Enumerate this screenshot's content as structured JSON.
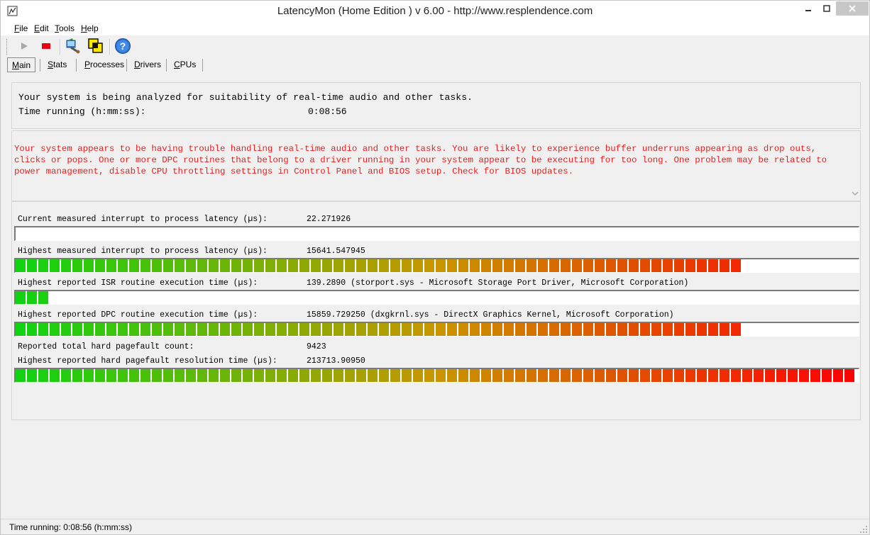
{
  "window": {
    "title": "LatencyMon  (Home Edition )  v 6.00 - http://www.resplendence.com"
  },
  "menu": [
    {
      "key": "F",
      "rest": "ile"
    },
    {
      "key": "E",
      "rest": "dit"
    },
    {
      "key": "T",
      "rest": "ools"
    },
    {
      "key": "H",
      "rest": "elp"
    }
  ],
  "toolbar": {
    "icons": [
      "play-icon",
      "stop-icon",
      "driver-check-icon",
      "windows-icon",
      "help-icon"
    ]
  },
  "tabs": [
    {
      "key": "M",
      "rest": "ain",
      "active": true
    },
    {
      "key": "S",
      "rest": "tats",
      "active": false
    },
    {
      "key": "P",
      "rest": "rocesses",
      "active": false
    },
    {
      "key": "D",
      "rest": "rivers",
      "active": false
    },
    {
      "key": "C",
      "rest": "PUs",
      "active": false
    }
  ],
  "summary": {
    "analysis_text": "Your system is being analyzed for suitability of real-time audio and other tasks.",
    "time_label": "Time running (h:mm:ss):",
    "time_value": "0:08:56"
  },
  "warning": {
    "text": "Your system appears to be having trouble handling real-time audio and other tasks. You are likely to experience buffer underruns appearing as drop outs, clicks or pops. One or more DPC routines that belong to a driver running in your system appear to be executing for too long. One problem may be related to power management, disable CPU throttling settings in Control Panel and BIOS setup. Check for BIOS updates.",
    "color": "#e81e1e"
  },
  "stats": {
    "current_latency": {
      "label": "Current measured interrupt to process latency (µs):",
      "value": "22.271926",
      "meter_level": 0.0
    },
    "highest_latency": {
      "label": "Highest measured interrupt to process latency (µs):",
      "value": "15641.547945",
      "meter_level": 0.86
    },
    "highest_isr": {
      "label": "Highest reported ISR routine execution time (µs):",
      "value": "139.2890  (storport.sys - Microsoft Storage Port Driver, Microsoft Corporation)",
      "meter_level": 0.04
    },
    "highest_dpc": {
      "label": "Highest reported DPC routine execution time (µs):",
      "value": "15859.729250  (dxgkrnl.sys - DirectX Graphics Kernel, Microsoft Corporation)",
      "meter_level": 0.86
    },
    "pagefault_count": {
      "label": "Reported total hard pagefault count:",
      "value": "9423"
    },
    "pagefault_resolution": {
      "label": "Highest reported hard pagefault resolution time (µs):",
      "value": "213713.90950",
      "meter_level": 1.0
    }
  },
  "status_bar": {
    "text": "Time running: 0:08:56  (h:mm:ss)"
  },
  "colors": {
    "meter_start": "#11d311",
    "meter_end": "#ff0000"
  }
}
